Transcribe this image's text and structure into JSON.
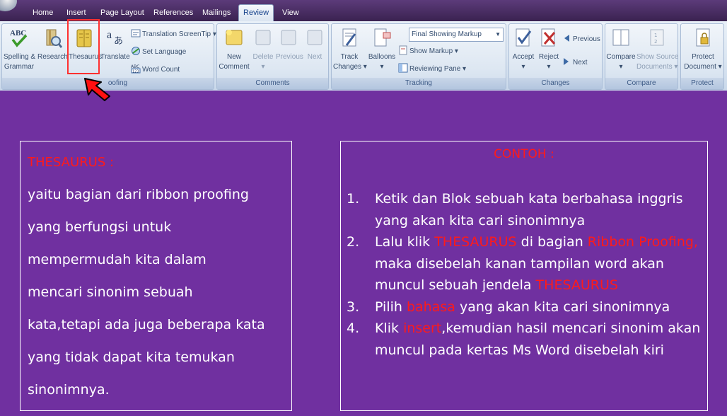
{
  "ribbon": {
    "tabs": [
      "Home",
      "Insert",
      "Page Layout",
      "References",
      "Mailings",
      "Review",
      "View"
    ],
    "active_tab": "Review",
    "proofing": {
      "label": "Proofing",
      "label_visible": "oofing",
      "spelling": [
        "Spelling &",
        "Grammar"
      ],
      "research": "Research",
      "thesaurus": "Thesaurus",
      "translate": "Translate",
      "translation_screentip": "Translation ScreenTip",
      "set_language": "Set Language",
      "word_count": "Word Count"
    },
    "comments": {
      "label": "Comments",
      "new_comment": [
        "New",
        "Comment"
      ],
      "delete": "Delete",
      "previous": "Previous",
      "next": "Next"
    },
    "tracking": {
      "label": "Tracking",
      "track_changes": [
        "Track",
        "Changes"
      ],
      "balloons": "Balloons",
      "markup_value": "Final Showing Markup",
      "show_markup": "Show Markup",
      "reviewing_pane": "Reviewing Pane"
    },
    "changes": {
      "label": "Changes",
      "accept": "Accept",
      "reject": "Reject",
      "previous": "Previous",
      "next": "Next"
    },
    "compare": {
      "label": "Compare",
      "compare": "Compare",
      "show_source": [
        "Show Source",
        "Documents"
      ]
    },
    "protect": {
      "label": "Protect",
      "protect_document": [
        "Protect",
        "Document"
      ]
    }
  },
  "left_panel": {
    "title": "THESAURUS :",
    "lines": [
      "yaitu bagian dari ribbon proofing",
      "yang berfungsi untuk",
      "mempermudah kita dalam",
      "mencari sinonim sebuah",
      "kata,tetapi ada juga beberapa kata",
      "yang tidak dapat kita temukan",
      "sinonimnya."
    ]
  },
  "right_panel": {
    "title": "CONTOH :",
    "steps": [
      {
        "num": "1.",
        "parts": [
          {
            "text": "Ketik dan Blok sebuah kata berbahasa inggris yang akan kita cari sinonimnya",
            "red": false
          }
        ]
      },
      {
        "num": "2.",
        "parts": [
          {
            "text": "Lalu klik ",
            "red": false
          },
          {
            "text": "THESAURUS",
            "red": true
          },
          {
            "text": " di bagian ",
            "red": false
          },
          {
            "text": "Ribbon Proofing,",
            "red": true
          },
          {
            "text": " maka disebelah kanan tampilan word akan muncul sebuah jendela ",
            "red": false
          },
          {
            "text": "THESAURUS",
            "red": true
          }
        ]
      },
      {
        "num": "3.",
        "parts": [
          {
            "text": "Pilih ",
            "red": false
          },
          {
            "text": "bahasa",
            "red": true
          },
          {
            "text": " yang akan kita cari sinonimnya",
            "red": false
          }
        ]
      },
      {
        "num": "4.",
        "parts": [
          {
            "text": "Klik ",
            "red": false
          },
          {
            "text": "insert",
            "red": true
          },
          {
            "text": ",kemudian hasil  mencari sinonim akan muncul pada kertas Ms Word disebelah kiri",
            "red": false
          }
        ]
      }
    ]
  },
  "colors": {
    "background": "#7030a0",
    "highlight": "#ff1a1a",
    "text": "#ffffff"
  }
}
